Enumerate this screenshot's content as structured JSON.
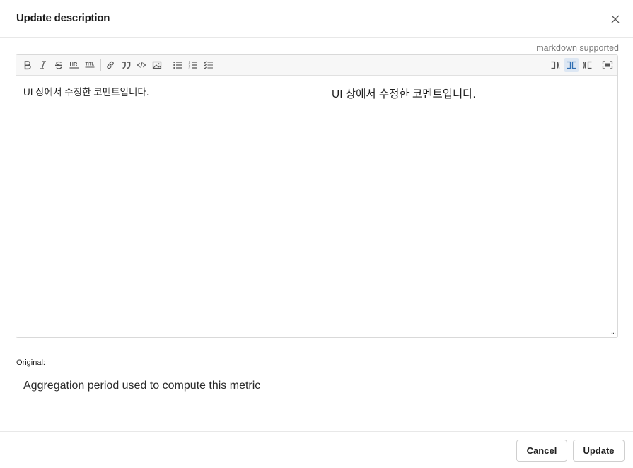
{
  "dialog": {
    "title": "Update description",
    "close_icon": "close-icon"
  },
  "editor": {
    "markdown_note": "markdown supported",
    "toolbar": {
      "left_groups": [
        [
          "bold-icon",
          "italic-icon",
          "strikethrough-icon",
          "horizontal-rule-icon",
          "heading-icon"
        ],
        [
          "link-icon",
          "quote-icon",
          "code-icon",
          "image-icon"
        ],
        [
          "bullet-list-icon",
          "numbered-list-icon",
          "task-list-icon"
        ]
      ],
      "right_buttons": [
        "editor-only-icon",
        "split-view-icon",
        "preview-only-icon",
        "fullscreen-icon"
      ],
      "active_view": "split-view"
    },
    "source_text": "UI 상에서 수정한 코멘트입니다.",
    "preview_text": "UI 상에서 수정한 코멘트입니다.",
    "more_label": "..."
  },
  "original": {
    "label": "Original:",
    "text": "Aggregation period used to compute this metric"
  },
  "footer": {
    "cancel_label": "Cancel",
    "update_label": "Update"
  },
  "colors": {
    "active_button_bg": "#dde7f3",
    "active_icon": "#2f6fb3",
    "toolbar_bg": "#f7f7f7"
  }
}
